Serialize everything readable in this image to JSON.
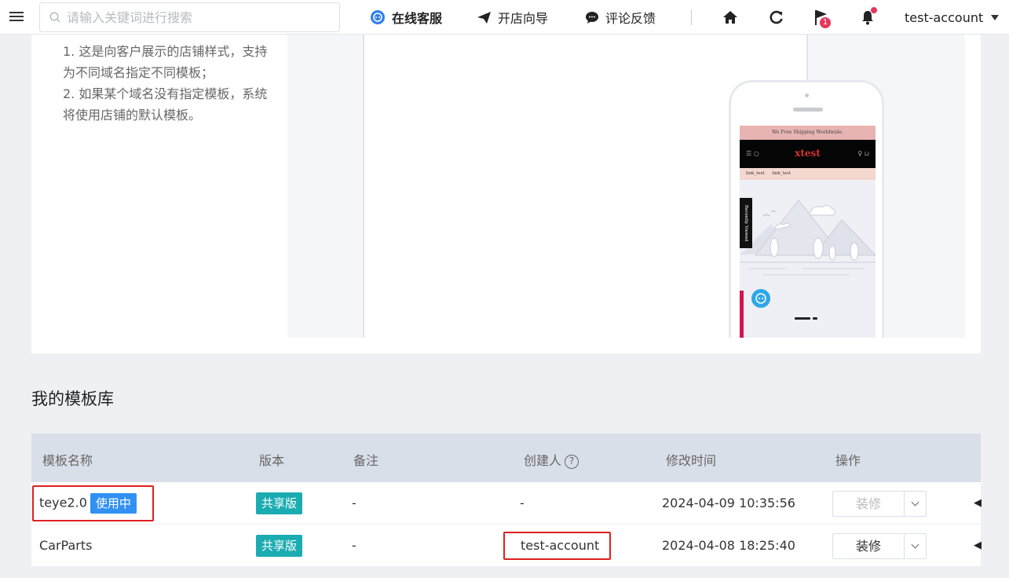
{
  "topbar": {
    "search_placeholder": "请输入关键词进行搜索",
    "nav": [
      {
        "label": "在线客服",
        "icon": "headset-icon"
      },
      {
        "label": "开店向导",
        "icon": "paper-plane-icon"
      },
      {
        "label": "评论反馈",
        "icon": "chat-bubble-icon"
      }
    ],
    "flag_badge": "1",
    "account": "test-account"
  },
  "intro": {
    "lines": [
      "1. 这是向客户展示的店铺样式，支持为不同域名指定不同模板；",
      "2. 如果某个域名没有指定模板，系统将使用店铺的默认模板。"
    ]
  },
  "phone_preview": {
    "shipping_bar": "We Free Shipping Worldwide.",
    "brand": "xtest",
    "links": [
      "link_test",
      "link_test"
    ],
    "side_tab": "Recently Viewed"
  },
  "library": {
    "title": "我的模板库",
    "columns": [
      "模板名称",
      "版本",
      "备注",
      "创建人",
      "修改时间",
      "操作"
    ],
    "rows": [
      {
        "name": "teye2.0",
        "status": "使用中",
        "version": "共享版",
        "note": "-",
        "creator": "-",
        "modified": "2024-04-09 10:35:56",
        "action": "装修",
        "action_disabled": true
      },
      {
        "name": "CarParts",
        "status": "",
        "version": "共享版",
        "note": "-",
        "creator": "test-account",
        "modified": "2024-04-08 18:25:40",
        "action": "装修",
        "action_disabled": false
      }
    ]
  },
  "colors": {
    "accent": "#3091f2",
    "shared_tag": "#1aacb1",
    "highlight": "#e02020",
    "badge": "#e6375b"
  }
}
